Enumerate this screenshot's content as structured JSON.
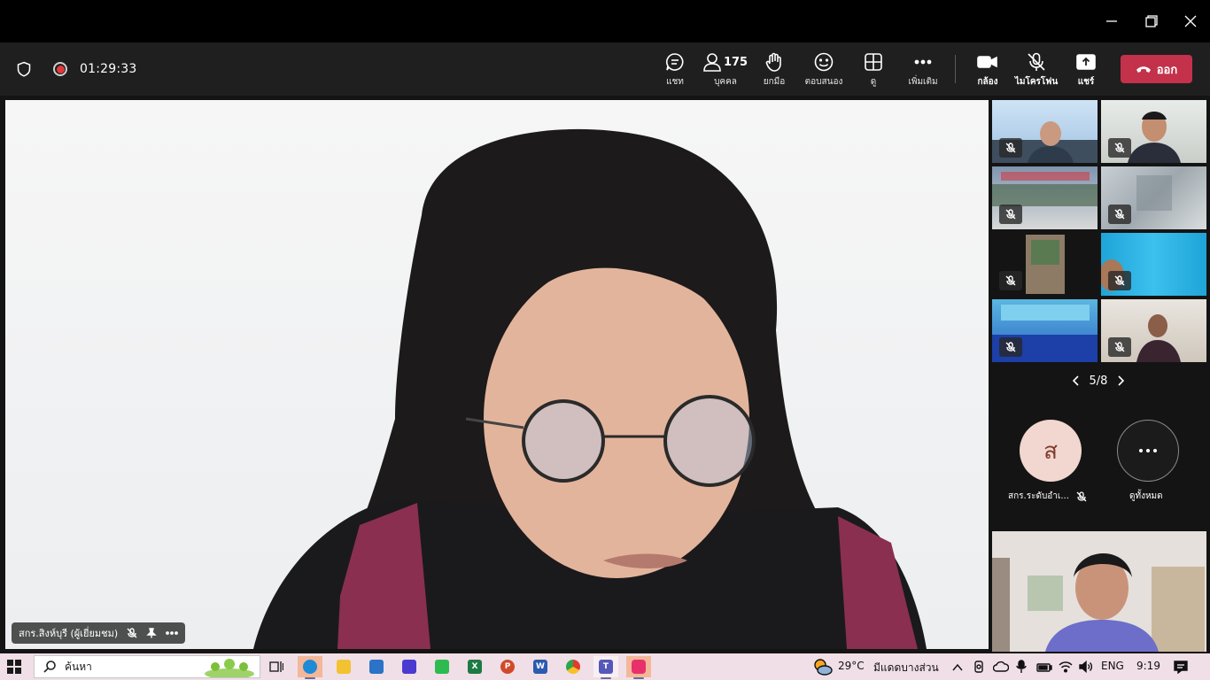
{
  "meeting": {
    "timer": "01:29:33",
    "participant_count": "175",
    "buttons": {
      "chat": "แชท",
      "people": "บุคคล",
      "raise_hand": "ยกมือ",
      "react": "ตอบสนอง",
      "view": "ดู",
      "more": "เพิ่มเติม",
      "camera": "กล้อง",
      "mic": "ไมโครโฟน",
      "share": "แชร์",
      "leave": "ออก"
    }
  },
  "main_video": {
    "name_label": "สกร.สิงห์บุรี (ผู้เยี่ยมชม)"
  },
  "gallery": {
    "page": "5/8",
    "avatar_initial": "ส",
    "avatar_name": "สกร.ระดับอำเ...",
    "view_all": "ดูทั้งหมด"
  },
  "taskbar": {
    "search_placeholder": "ค้นหา",
    "weather": "29°C",
    "weather_desc": "มีแดดบางส่วน",
    "language": "ENG",
    "time": "9:19"
  },
  "colors": {
    "leave": "#c4314b",
    "toolbar": "#1f1f1f",
    "taskbar": "#f0dfe6",
    "avatar_bg": "#f1d7cf"
  }
}
